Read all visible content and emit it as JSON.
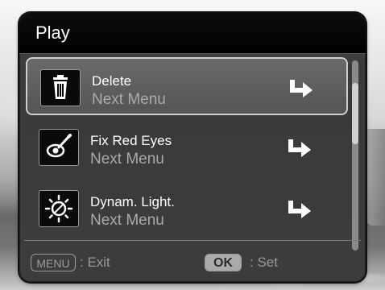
{
  "header": {
    "title": "Play"
  },
  "menu": {
    "items": [
      {
        "label": "Delete",
        "sublabel": "Next Menu",
        "icon": "trash-icon",
        "selected": true
      },
      {
        "label": "Fix Red Eyes",
        "sublabel": "Next Menu",
        "icon": "red-eye-fix-icon",
        "selected": false
      },
      {
        "label": "Dynam. Light.",
        "sublabel": "Next Menu",
        "icon": "dynamic-light-icon",
        "selected": false
      }
    ]
  },
  "footer": {
    "menu_key": "MENU",
    "menu_action": ": Exit",
    "ok_key": "OK",
    "ok_action": ": Set"
  },
  "colors": {
    "title_bar": "#000000",
    "panel": "#3c3c3c",
    "selected_highlight": "#cfcfcf",
    "text_primary": "#ffffff",
    "text_secondary": "#aaaaaa"
  }
}
